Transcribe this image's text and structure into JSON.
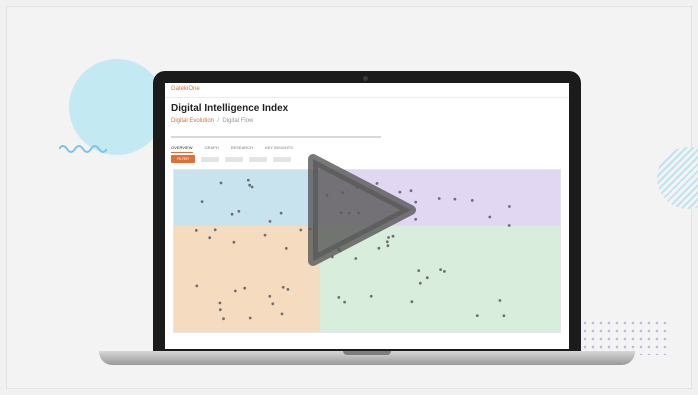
{
  "app": {
    "brand": "GatekiOne",
    "page_title": "Digital Intelligence Index",
    "breadcrumb": [
      "Digital Evolution",
      "Digital Flow"
    ]
  },
  "tabs": [
    "OVERVIEW",
    "GRAPH",
    "RESEARCH",
    "KEY INSIGHTS"
  ],
  "toolbar": {
    "filter_label": "FILTER"
  },
  "quadrants": [
    {
      "name": "top-left",
      "color": "#bcdcea"
    },
    {
      "name": "top-right",
      "color": "#d9cdf0"
    },
    {
      "name": "bottom-left",
      "color": "#f3d3b0"
    },
    {
      "name": "bottom-right",
      "color": "#d0e8d4"
    }
  ],
  "icons": {
    "play": "play-icon",
    "wave": "wave-decoration-icon"
  },
  "colors": {
    "accent": "#e0703a",
    "play_overlay": "#5a5a5a",
    "deco_circle": "#c3e9f3",
    "wave": "#7cc5e2"
  }
}
